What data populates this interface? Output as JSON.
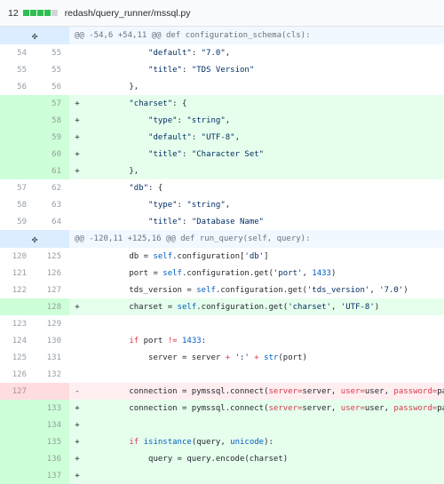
{
  "file": {
    "change_count": "12",
    "path": "redash/query_runner/mssql.py",
    "stat_blocks": [
      "add",
      "add",
      "add",
      "add",
      "neutral"
    ]
  },
  "rows": [
    {
      "kind": "hunk",
      "icon": "expand-icon",
      "text": "@@ -54,6 +54,11 @@ def configuration_schema(cls):"
    },
    {
      "kind": "ctx",
      "old": "54",
      "new": "55",
      "sign": "",
      "tokens": [
        [
          "plain",
          "            "
        ],
        [
          "str",
          "\"default\""
        ],
        [
          "plain",
          ": "
        ],
        [
          "str",
          "\"7.0\""
        ],
        [
          "plain",
          ","
        ]
      ]
    },
    {
      "kind": "ctx",
      "old": "55",
      "new": "55",
      "sign": "",
      "tokens": [
        [
          "plain",
          "            "
        ],
        [
          "str",
          "\"title\""
        ],
        [
          "plain",
          ": "
        ],
        [
          "str",
          "\"TDS Version\""
        ]
      ]
    },
    {
      "kind": "ctx",
      "old": "56",
      "new": "56",
      "sign": "",
      "tokens": [
        [
          "plain",
          "        },"
        ]
      ]
    },
    {
      "kind": "add",
      "old": "",
      "new": "57",
      "sign": "+",
      "tokens": [
        [
          "plain",
          "        "
        ],
        [
          "str",
          "\"charset\""
        ],
        [
          "plain",
          ": {"
        ]
      ]
    },
    {
      "kind": "add",
      "old": "",
      "new": "58",
      "sign": "+",
      "tokens": [
        [
          "plain",
          "            "
        ],
        [
          "str",
          "\"type\""
        ],
        [
          "plain",
          ": "
        ],
        [
          "str",
          "\"string\""
        ],
        [
          "plain",
          ","
        ]
      ]
    },
    {
      "kind": "add",
      "old": "",
      "new": "59",
      "sign": "+",
      "tokens": [
        [
          "plain",
          "            "
        ],
        [
          "str",
          "\"default\""
        ],
        [
          "plain",
          ": "
        ],
        [
          "str",
          "\"UTF-8\""
        ],
        [
          "plain",
          ","
        ]
      ]
    },
    {
      "kind": "add",
      "old": "",
      "new": "60",
      "sign": "+",
      "tokens": [
        [
          "plain",
          "            "
        ],
        [
          "str",
          "\"title\""
        ],
        [
          "plain",
          ": "
        ],
        [
          "str",
          "\"Character Set\""
        ]
      ]
    },
    {
      "kind": "add",
      "old": "",
      "new": "61",
      "sign": "+",
      "tokens": [
        [
          "plain",
          "        },"
        ]
      ]
    },
    {
      "kind": "ctx",
      "old": "57",
      "new": "62",
      "sign": "",
      "tokens": [
        [
          "plain",
          "        "
        ],
        [
          "str",
          "\"db\""
        ],
        [
          "plain",
          ": {"
        ]
      ]
    },
    {
      "kind": "ctx",
      "old": "58",
      "new": "63",
      "sign": "",
      "tokens": [
        [
          "plain",
          "            "
        ],
        [
          "str",
          "\"type\""
        ],
        [
          "plain",
          ": "
        ],
        [
          "str",
          "\"string\""
        ],
        [
          "plain",
          ","
        ]
      ]
    },
    {
      "kind": "ctx",
      "old": "59",
      "new": "64",
      "sign": "",
      "tokens": [
        [
          "plain",
          "            "
        ],
        [
          "str",
          "\"title\""
        ],
        [
          "plain",
          ": "
        ],
        [
          "str",
          "\"Database Name\""
        ]
      ]
    },
    {
      "kind": "hunk",
      "icon": "expand-icon",
      "text": "@@ -120,11 +125,16 @@ def run_query(self, query):"
    },
    {
      "kind": "ctx",
      "old": "120",
      "new": "125",
      "sign": "",
      "tokens": [
        [
          "plain",
          "        db = "
        ],
        [
          "attr",
          "self"
        ],
        [
          "plain",
          ".configuration["
        ],
        [
          "str",
          "'db'"
        ],
        [
          "plain",
          "]"
        ]
      ]
    },
    {
      "kind": "ctx",
      "old": "121",
      "new": "126",
      "sign": "",
      "tokens": [
        [
          "plain",
          "        port = "
        ],
        [
          "attr",
          "self"
        ],
        [
          "plain",
          ".configuration.get("
        ],
        [
          "str",
          "'port'"
        ],
        [
          "plain",
          ", "
        ],
        [
          "num-lit",
          "1433"
        ],
        [
          "plain",
          ")"
        ]
      ]
    },
    {
      "kind": "ctx",
      "old": "122",
      "new": "127",
      "sign": "",
      "tokens": [
        [
          "plain",
          "        tds_version = "
        ],
        [
          "attr",
          "self"
        ],
        [
          "plain",
          ".configuration.get("
        ],
        [
          "str",
          "'tds_version'"
        ],
        [
          "plain",
          ", "
        ],
        [
          "str",
          "'7.0'"
        ],
        [
          "plain",
          ")"
        ]
      ]
    },
    {
      "kind": "add",
      "old": "",
      "new": "128",
      "sign": "+",
      "tokens": [
        [
          "plain",
          "        charset = "
        ],
        [
          "attr",
          "self"
        ],
        [
          "plain",
          ".configuration.get("
        ],
        [
          "str",
          "'charset'"
        ],
        [
          "plain",
          ", "
        ],
        [
          "str",
          "'UTF-8'"
        ],
        [
          "plain",
          ")"
        ]
      ]
    },
    {
      "kind": "ctx",
      "old": "123",
      "new": "129",
      "sign": "",
      "tokens": []
    },
    {
      "kind": "ctx",
      "old": "124",
      "new": "130",
      "sign": "",
      "tokens": [
        [
          "plain",
          "        "
        ],
        [
          "kw",
          "if"
        ],
        [
          "plain",
          " port "
        ],
        [
          "kw",
          "!="
        ],
        [
          "plain",
          " "
        ],
        [
          "num-lit",
          "1433"
        ],
        [
          "plain",
          ":"
        ]
      ]
    },
    {
      "kind": "ctx",
      "old": "125",
      "new": "131",
      "sign": "",
      "tokens": [
        [
          "plain",
          "            server = server "
        ],
        [
          "kw",
          "+"
        ],
        [
          "plain",
          " "
        ],
        [
          "str",
          "':'"
        ],
        [
          "plain",
          " "
        ],
        [
          "kw",
          "+"
        ],
        [
          "plain",
          " "
        ],
        [
          "attr",
          "str"
        ],
        [
          "plain",
          "(port)"
        ]
      ]
    },
    {
      "kind": "ctx",
      "old": "126",
      "new": "132",
      "sign": "",
      "tokens": []
    },
    {
      "kind": "del",
      "old": "127",
      "new": "",
      "sign": "-",
      "tokens": [
        [
          "plain",
          "        connection = pymssql.connect("
        ],
        [
          "kw",
          "server"
        ],
        [
          "kw",
          "="
        ],
        [
          "plain",
          "server, "
        ],
        [
          "kw",
          "user"
        ],
        [
          "kw",
          "="
        ],
        [
          "plain",
          "user, "
        ],
        [
          "kw",
          "password"
        ],
        [
          "kw",
          "="
        ],
        [
          "plain",
          "pass"
        ]
      ]
    },
    {
      "kind": "add",
      "old": "",
      "new": "133",
      "sign": "+",
      "tokens": [
        [
          "plain",
          "        connection = pymssql.connect("
        ],
        [
          "kw",
          "server"
        ],
        [
          "kw",
          "="
        ],
        [
          "plain",
          "server, "
        ],
        [
          "kw",
          "user"
        ],
        [
          "kw",
          "="
        ],
        [
          "plain",
          "user, "
        ],
        [
          "kw",
          "password"
        ],
        [
          "kw",
          "="
        ],
        [
          "plain",
          "pass"
        ]
      ]
    },
    {
      "kind": "add",
      "old": "",
      "new": "134",
      "sign": "+",
      "tokens": []
    },
    {
      "kind": "add",
      "old": "",
      "new": "135",
      "sign": "+",
      "tokens": [
        [
          "plain",
          "        "
        ],
        [
          "kw",
          "if"
        ],
        [
          "plain",
          " "
        ],
        [
          "attr",
          "isinstance"
        ],
        [
          "plain",
          "(query, "
        ],
        [
          "attr",
          "unicode"
        ],
        [
          "plain",
          "):"
        ]
      ]
    },
    {
      "kind": "add",
      "old": "",
      "new": "136",
      "sign": "+",
      "tokens": [
        [
          "plain",
          "            query = query.encode(charset)"
        ]
      ]
    },
    {
      "kind": "add",
      "old": "",
      "new": "137",
      "sign": "+",
      "tokens": []
    }
  ]
}
